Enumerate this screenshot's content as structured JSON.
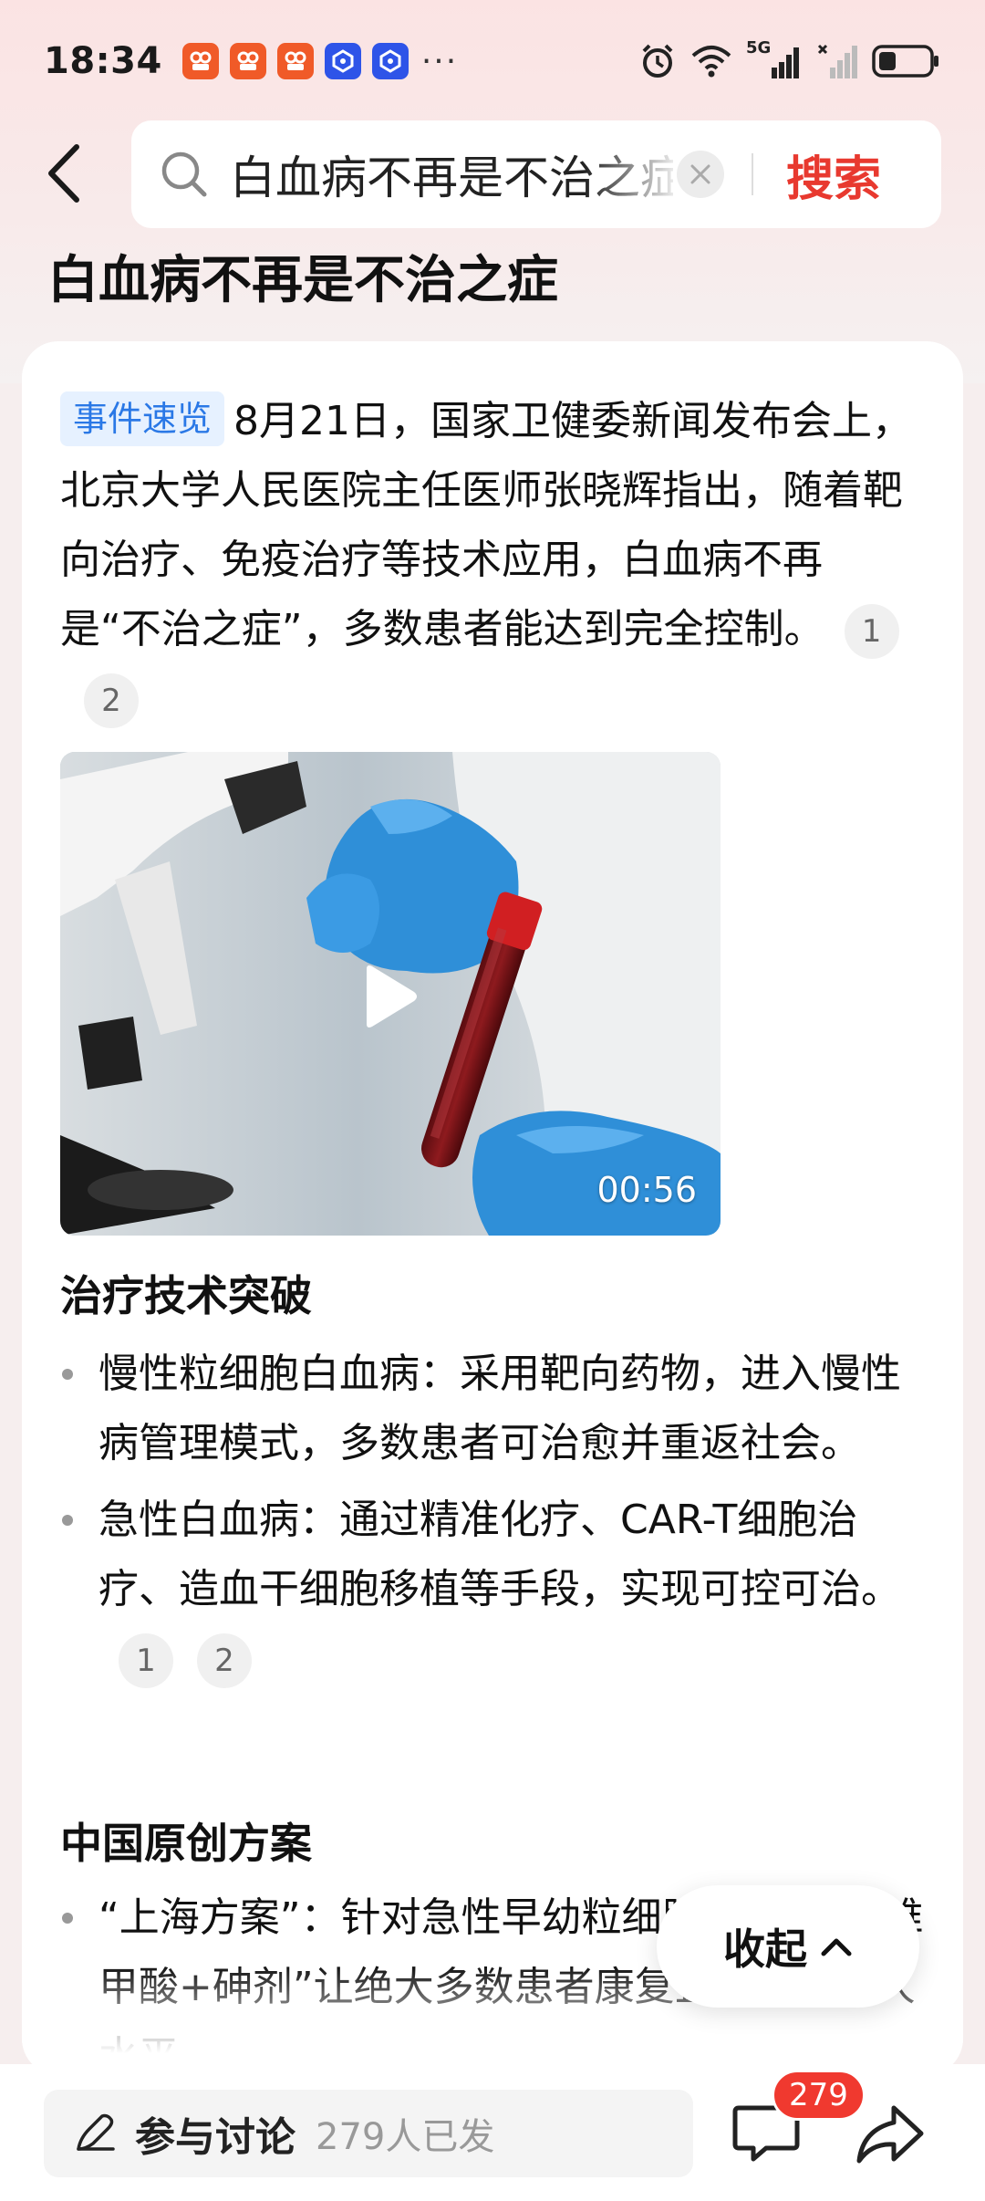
{
  "status_bar": {
    "time": "18:34",
    "more": "···",
    "network": "5G"
  },
  "search": {
    "query": "白血病不再是不治之症",
    "submit_label": "搜索"
  },
  "page_title": "白血病不再是不治之症",
  "summary": {
    "tag": "事件速览",
    "text": "8月21日，国家卫健委新闻发布会上，北京大学人民医院主任医师张晓辉指出，随着靶向治疗、免疫治疗等技术应用，白血病不再是“不治之症”，多数患者能达到完全控制。",
    "citations": [
      "1",
      "2"
    ]
  },
  "video": {
    "duration": "00:56"
  },
  "sections": [
    {
      "heading": "治疗技术突破",
      "bullets": [
        {
          "text": "慢性粒细胞白血病：采用靶向药物，进入慢性病管理模式，多数患者可治愈并重返社会。",
          "citations": []
        },
        {
          "text": "急性白血病：通过精准化疗、CAR-T细胞治疗、造血干细胞移植等手段，实现可控可治。",
          "citations": [
            "1",
            "2"
          ]
        }
      ]
    },
    {
      "heading": "中国原创方案",
      "bullets": [
        {
          "text": "“上海方案”：针对急性早幼粒细胞白血病，“维甲酸+砷剂”让绝大多数患者康复且达到正常人水平",
          "citations": []
        }
      ]
    }
  ],
  "collapse_label": "收起",
  "bottom_bar": {
    "discuss_label": "参与讨论",
    "discuss_count": "279人已发",
    "comment_badge": "279"
  },
  "colors": {
    "accent_red": "#e8392f",
    "tag_blue": "#2a78e6",
    "badge_red": "#f0392f"
  }
}
